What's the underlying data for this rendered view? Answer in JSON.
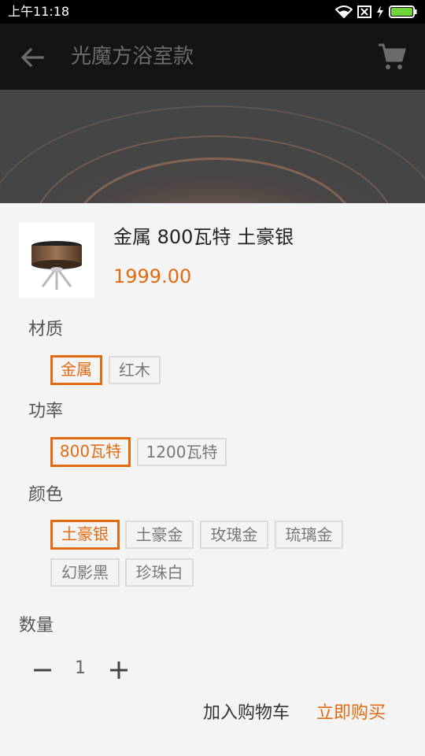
{
  "status_bar": {
    "time": "上午11:18",
    "icons": [
      "wifi-icon",
      "no-sim-icon",
      "charging-icon",
      "battery-icon"
    ],
    "battery_color": "#6fd43a"
  },
  "app_bar": {
    "title": "光魔方浴室款",
    "back_icon": "arrow-left-icon",
    "cart_icon": "shopping-cart-icon"
  },
  "product": {
    "name": "金属 800瓦特 土豪银",
    "price": "1999.00"
  },
  "options": {
    "material": {
      "label": "材质",
      "items": [
        "金属",
        "红木"
      ],
      "selected": "金属"
    },
    "power": {
      "label": "功率",
      "items": [
        "800瓦特",
        "1200瓦特"
      ],
      "selected": "800瓦特"
    },
    "color": {
      "label": "颜色",
      "items": [
        "土豪银",
        "土豪金",
        "玫瑰金",
        "琉璃金",
        "幻影黑",
        "珍珠白"
      ],
      "selected": "土豪银"
    }
  },
  "quantity": {
    "label": "数量",
    "value": "1"
  },
  "actions": {
    "add_to_cart": "加入购物车",
    "buy_now": "立即购买"
  },
  "colors": {
    "accent": "#e26b12",
    "app_bar": "#141414",
    "sheet": "#f4f4f4"
  }
}
